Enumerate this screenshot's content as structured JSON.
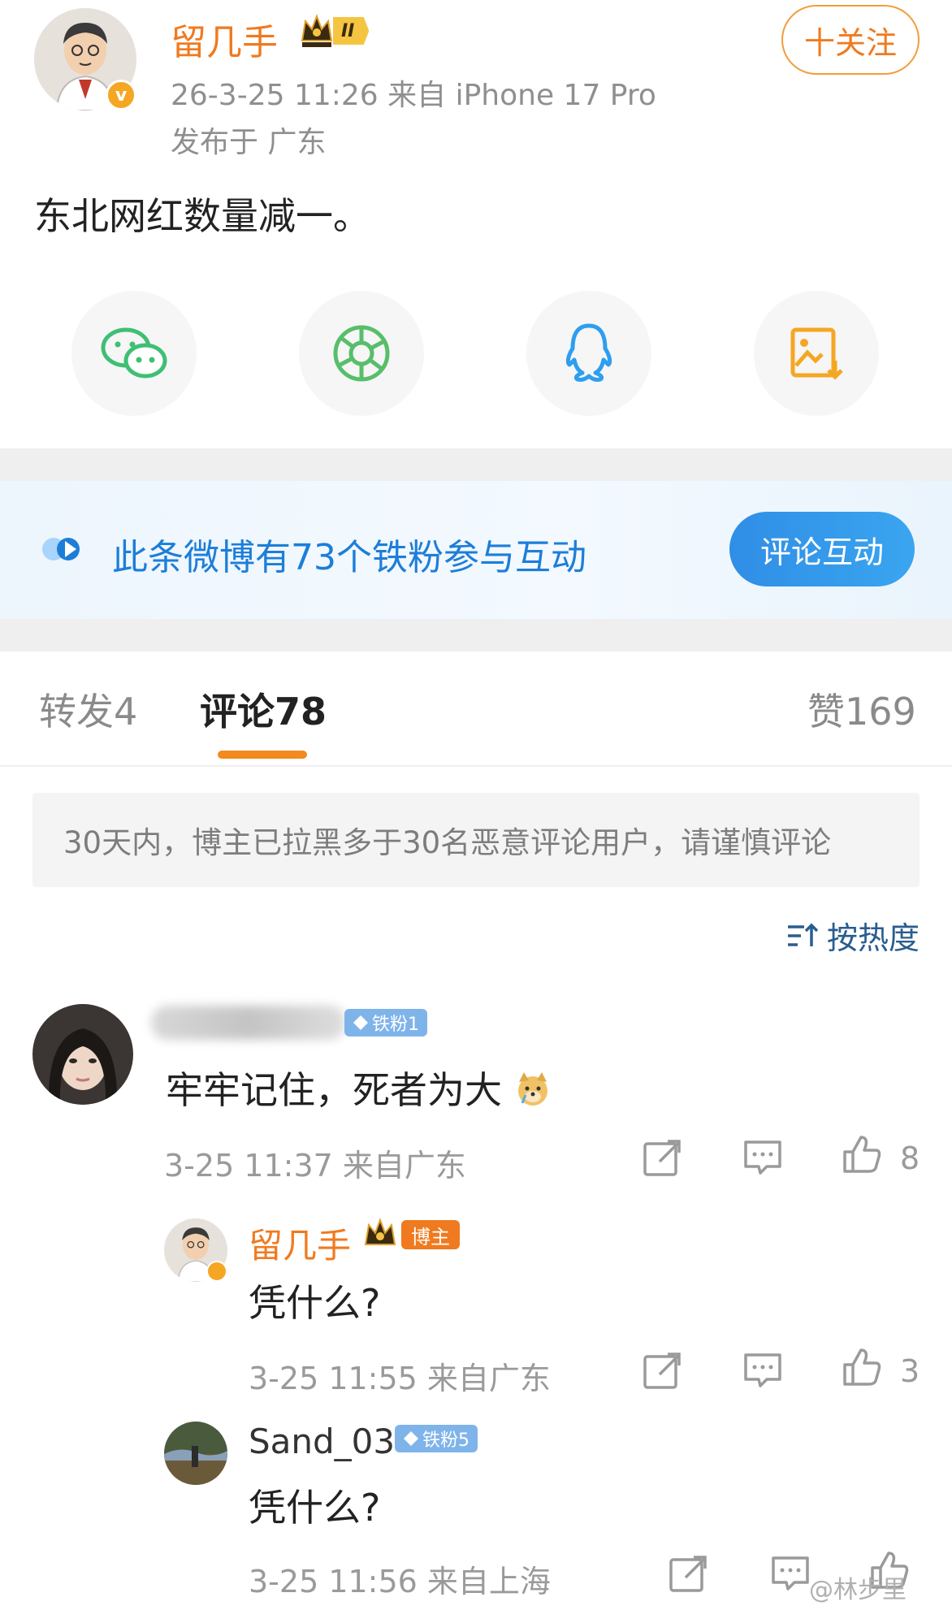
{
  "post": {
    "author": "留几手",
    "meta": "26-3-25 11:26   来自 iPhone 17 Pro",
    "location": "发布于 广东",
    "follow_label": "十关注",
    "text": "东北网红数量减一。",
    "level_badge": "II",
    "verified_mark": "v"
  },
  "share_icons": [
    "wechat-icon",
    "moments-icon",
    "qq-icon",
    "save-image-icon"
  ],
  "fans_banner": {
    "text": "此条微博有73个铁粉参与互动",
    "button": "评论互动"
  },
  "tabs": [
    {
      "label": "转发",
      "count": "4"
    },
    {
      "label": "评论",
      "count": "78"
    },
    {
      "label": "赞",
      "count": "169"
    }
  ],
  "notice": "30天内，博主已拉黑多于30名恶意评论用户，请谨慎评论",
  "sort_label": "按热度",
  "comments": [
    {
      "badge": "铁粉1",
      "text": "牢牢记住，死者为大",
      "meta": "3-25 11:37  来自广东",
      "likes": "8"
    },
    {
      "name": "留几手",
      "badge": "博主",
      "text": "凭什么?",
      "meta": "3-25 11:55  来自广东",
      "likes": "3"
    },
    {
      "name": "Sand_03",
      "badge": "铁粉5",
      "text": "凭什么?",
      "meta": "3-25 11:56  来自上海",
      "likes": ""
    }
  ],
  "watermark": "@林步里",
  "colors": {
    "accent_orange": "#f07a1f",
    "link_blue": "#1d7ed8",
    "fan_badge_blue": "#7fb4ea"
  }
}
